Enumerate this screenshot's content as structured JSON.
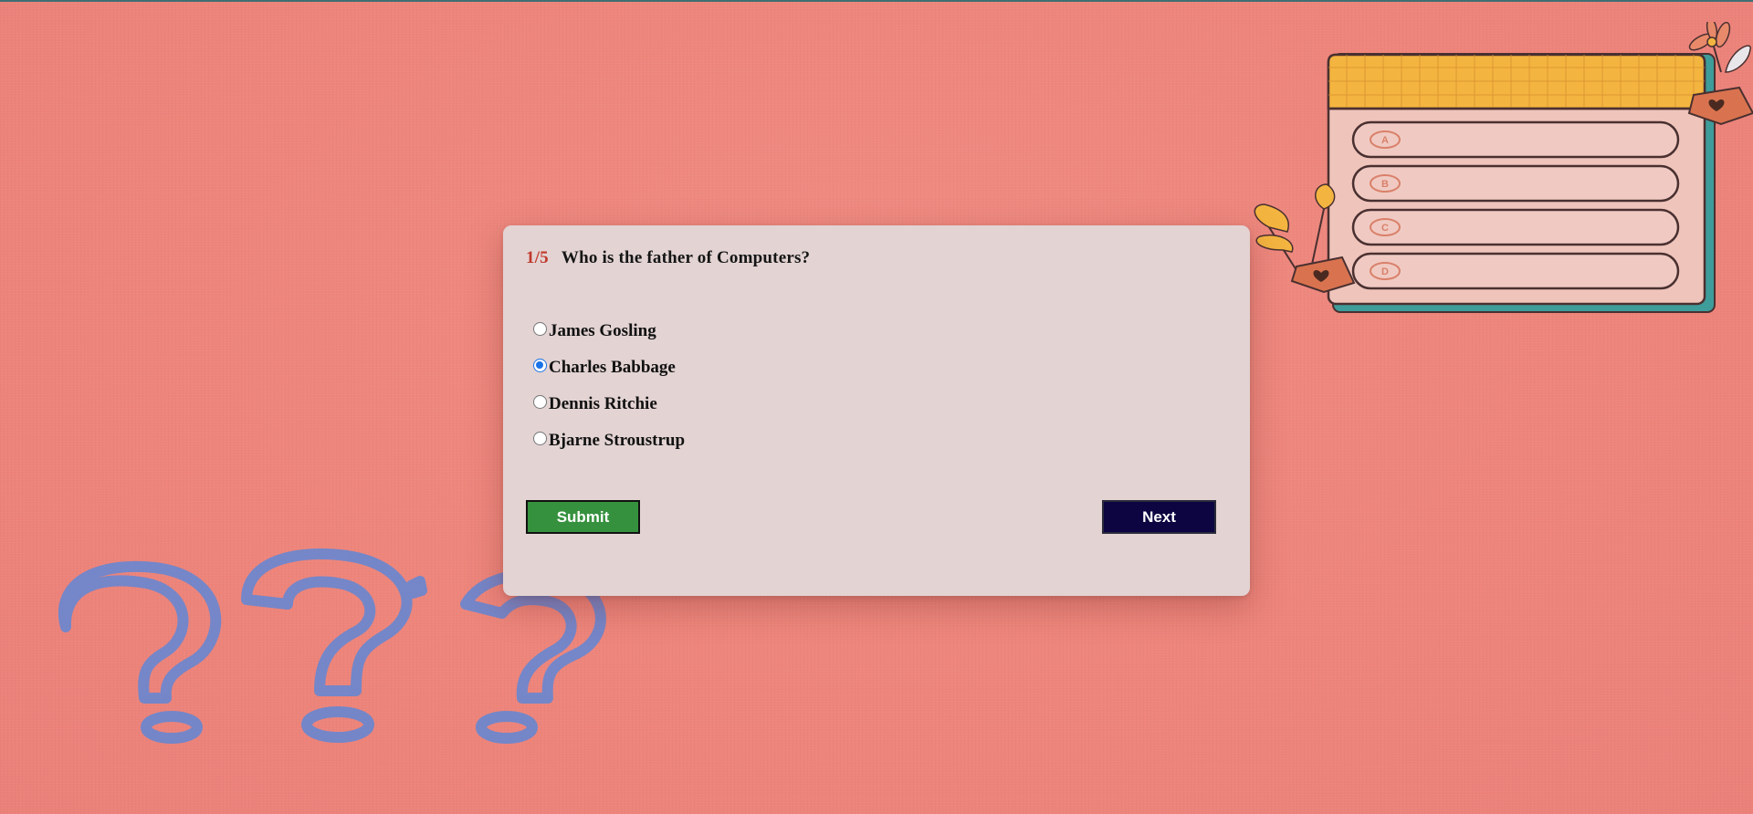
{
  "quiz": {
    "progress": "1/5",
    "question": "Who is the father of Computers?",
    "options": [
      {
        "label": "James Gosling",
        "selected": false
      },
      {
        "label": "Charles Babbage",
        "selected": true
      },
      {
        "label": "Dennis Ritchie",
        "selected": false
      },
      {
        "label": "Bjarne Stroustrup",
        "selected": false
      }
    ],
    "submit_label": "Submit",
    "next_label": "Next"
  },
  "decorations": {
    "illustration_letters": [
      "A",
      "B",
      "C",
      "D"
    ],
    "question_mark_color": "#6a87cf"
  },
  "colors": {
    "background": "#ee857b",
    "card": "#e3d3d3",
    "progress_text": "#c0392b",
    "submit_button": "#36913e",
    "next_button": "#0c0541",
    "radio_selected": "#1a73e8"
  }
}
